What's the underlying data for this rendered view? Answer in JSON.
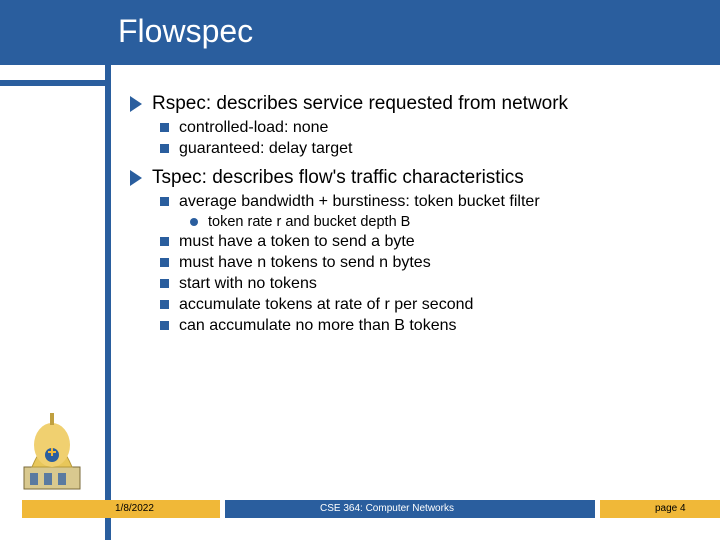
{
  "title": "Flowspec",
  "bullets": {
    "rspec": {
      "label": "Rspec: describes service requested from network",
      "items": [
        "controlled-load: none",
        "guaranteed: delay target"
      ]
    },
    "tspec": {
      "label": "Tspec: describes flow's traffic characteristics",
      "first": "average bandwidth + burstiness: token bucket filter",
      "sub": "token rate r and bucket depth B",
      "rest": [
        "must have a token to send a byte",
        "must have n tokens to send n bytes",
        "start with no tokens",
        "accumulate tokens at rate of r per second",
        "can accumulate no more than B tokens"
      ]
    }
  },
  "footer": {
    "date": "1/8/2022",
    "course": "CSE 364: Computer Networks",
    "page": "page 4"
  },
  "colors": {
    "blue": "#2a5e9e",
    "gold": "#f0b838"
  }
}
